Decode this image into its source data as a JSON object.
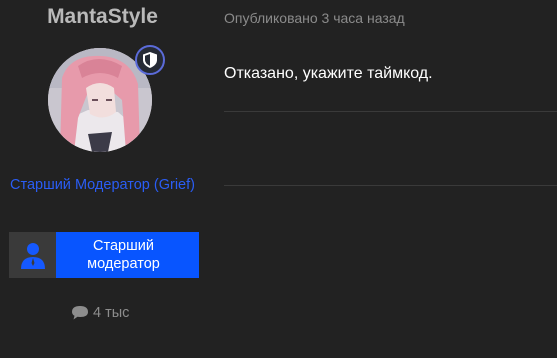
{
  "author": {
    "username": "MantaStyle",
    "title": "Старший Модератор (Grief)",
    "rank_badge_label": "Старший модератор",
    "reputation": "4 тыс"
  },
  "post": {
    "meta": "Опубликовано 3 часа назад",
    "body": "Отказано, укажите таймкод."
  },
  "colors": {
    "background": "#222222",
    "accent_blue": "#0855ff",
    "title_blue": "#2a5df5"
  },
  "icons": {
    "group_badge": "shield-icon",
    "rank_badge": "user-icon",
    "reputation": "speech-bubble-icon"
  }
}
